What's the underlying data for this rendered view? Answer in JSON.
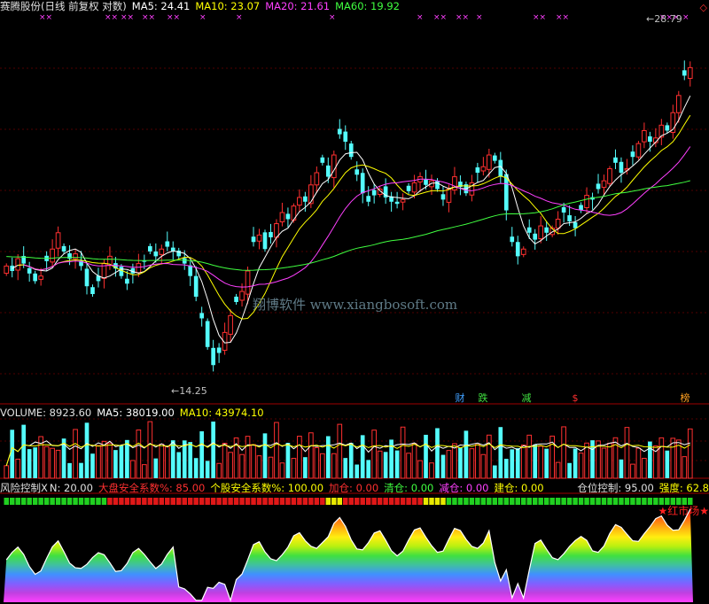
{
  "header": {
    "title": "赛腾股份(日线 前复权 对数)",
    "ma5_label": "MA5: 24.41",
    "ma10_label": "MA10: 23.07",
    "ma20_label": "MA20: 21.61",
    "ma60_label": "MA60: 19.92",
    "corner_icon": "◇"
  },
  "price_panel": {
    "high_label": "28.79",
    "low_label": "14.25",
    "watermark": "翔博软件  www.xiangbosoft.com",
    "badges": [
      {
        "text": "财",
        "color": "#40a0ff"
      },
      {
        "text": "跌",
        "color": "#40e040"
      },
      {
        "text": "减",
        "color": "#40e040"
      },
      {
        "text": "$",
        "color": "#ff3030"
      },
      {
        "text": "榜",
        "color": "#ffa020"
      }
    ]
  },
  "volume_panel": {
    "label": "VOLUME: 8923.60",
    "ma5_label": "MA5: 38019.00",
    "ma10_label": "MA10: 43974.10"
  },
  "risk_panel": {
    "title": "风险控制X",
    "n_label": "N: 20.00",
    "market_safety": "大盘安全系数%: 85.00",
    "stock_safety": "个股安全系数%: 100.00",
    "add": "加仓: 0.00",
    "clear": "清仓: 0.00",
    "reduce": "减仓: 0.00",
    "build": "建仓: 0.00",
    "position": "仓位控制: 95.00",
    "strength": "强度: 62.8",
    "red_market": "★红市场★"
  },
  "colors": {
    "up": "#ff3030",
    "down": "#54fcfc",
    "ma5": "#ffffff",
    "ma10": "#ffff00",
    "ma20": "#ff40ff",
    "ma60": "#40ff40",
    "grid": "#a00000"
  },
  "chart_data": [
    {
      "type": "candlestick",
      "title": "赛腾股份(日线 前复权 对数)",
      "ylim": [
        13.5,
        31.5
      ],
      "scale": "log",
      "annotations": [
        "28.79",
        "14.25"
      ],
      "series": [
        {
          "name": "MA5",
          "value": 24.41
        },
        {
          "name": "MA10",
          "value": 23.07
        },
        {
          "name": "MA20",
          "value": 21.61
        },
        {
          "name": "MA60",
          "value": 19.92
        }
      ],
      "closes": [
        18.2,
        18.0,
        18.5,
        18.3,
        17.9,
        17.6,
        17.8,
        18.4,
        18.9,
        19.6,
        18.8,
        18.5,
        18.7,
        18.2,
        17.4,
        17.1,
        17.6,
        18.3,
        18.6,
        18.1,
        17.8,
        17.5,
        17.9,
        18.3,
        18.4,
        18.8,
        18.6,
        18.9,
        19.0,
        18.8,
        18.6,
        18.3,
        17.8,
        17.0,
        16.2,
        15.2,
        14.6,
        15.0,
        15.7,
        16.3,
        16.8,
        17.2,
        18.0,
        19.2,
        19.5,
        18.9,
        19.4,
        20.0,
        20.5,
        20.2,
        20.8,
        21.2,
        21.0,
        21.8,
        22.4,
        22.9,
        22.2,
        23.3,
        24.4,
        24.0,
        23.2,
        22.3,
        21.4,
        21.0,
        21.3,
        21.6,
        21.2,
        21.0,
        20.9,
        21.1,
        21.5,
        21.9,
        22.2,
        21.8,
        22.0,
        21.6,
        21.1,
        21.6,
        22.2,
        21.7,
        21.4,
        21.9,
        22.4,
        22.7,
        23.3,
        23.0,
        22.2,
        20.6,
        19.2,
        18.6,
        18.9,
        19.6,
        19.3,
        19.9,
        19.6,
        19.8,
        20.2,
        20.5,
        20.1,
        19.8,
        20.6,
        21.3,
        21.1,
        21.6,
        22.0,
        22.6,
        22.9,
        22.4,
        22.6,
        23.2,
        23.9,
        24.6,
        24.0,
        24.2,
        24.9,
        24.6,
        25.6,
        26.6,
        27.8,
        28.3
      ],
      "volume": {
        "label": "VOLUME",
        "last": 8923.6,
        "ma5": 38019.0,
        "ma10": 43974.1
      },
      "risk_control": {
        "N": 20.0,
        "market_safety_pct": 85.0,
        "stock_safety_pct": 100.0,
        "add": 0.0,
        "clear": 0.0,
        "reduce": 0.0,
        "build": 0.0,
        "position_control": 95.0,
        "strength": 62.8
      }
    }
  ]
}
